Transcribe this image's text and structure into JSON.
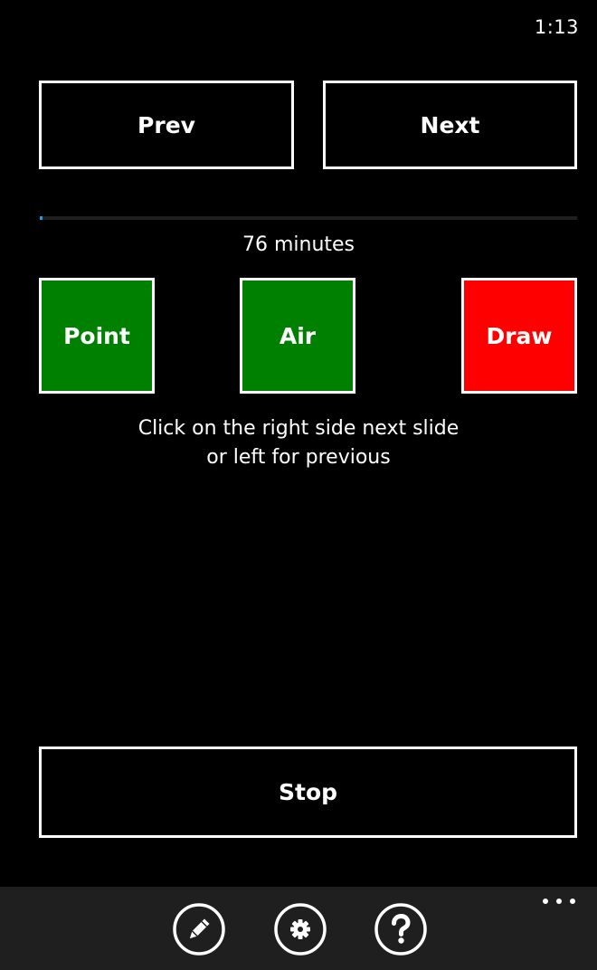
{
  "status_bar": {
    "time": "1:13"
  },
  "navigation": {
    "prev_label": "Prev",
    "next_label": "Next"
  },
  "progress": {
    "fraction": 0.004,
    "color": "#1ba1e2"
  },
  "duration": {
    "label": "76 minutes"
  },
  "tools": [
    {
      "label": "Point",
      "color": "#008000"
    },
    {
      "label": "Air",
      "color": "#008000"
    },
    {
      "label": "Draw",
      "color": "#ff0000"
    }
  ],
  "instructions": {
    "line1": "Click on the right side next slide",
    "line2": "or left for previous"
  },
  "stop": {
    "label": "Stop"
  },
  "app_bar": {
    "buttons": [
      {
        "icon": "pencil-icon"
      },
      {
        "icon": "gear-icon"
      },
      {
        "icon": "question-icon"
      }
    ],
    "more_icon": "ellipsis-icon"
  }
}
